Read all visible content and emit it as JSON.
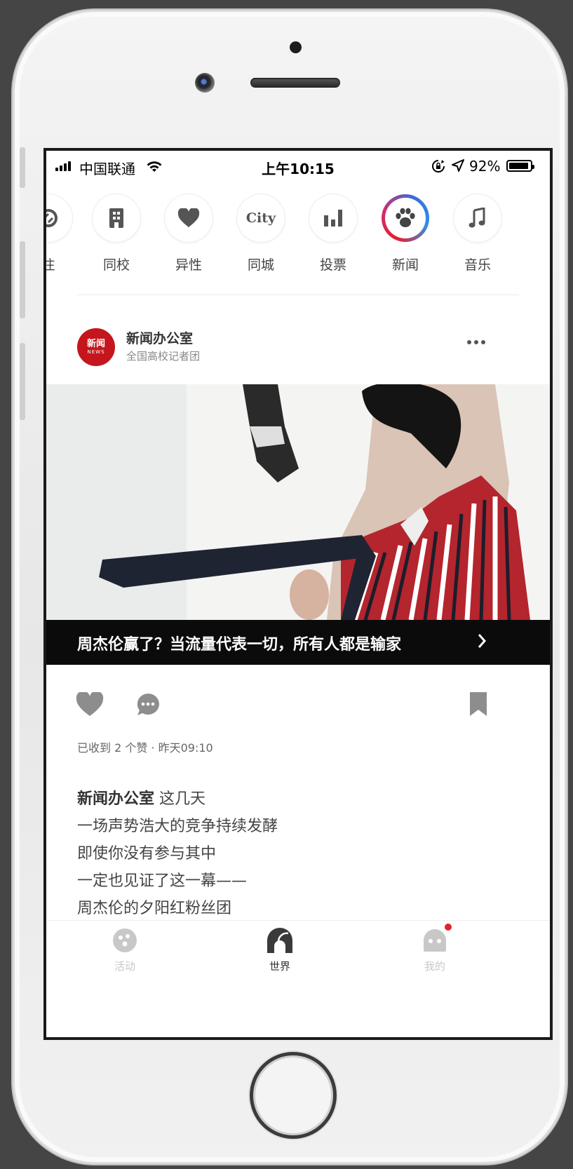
{
  "status_bar": {
    "carrier": "中国联通",
    "time": "上午10:15",
    "battery": "92%",
    "battery_level": 0.92
  },
  "categories": [
    {
      "label": "注",
      "icon": "focus-icon",
      "active": false
    },
    {
      "label": "同校",
      "icon": "building-icon",
      "active": false
    },
    {
      "label": "异性",
      "icon": "heart-icon",
      "active": false
    },
    {
      "label": "同城",
      "icon": "city-icon",
      "icon_text": "City",
      "active": false
    },
    {
      "label": "投票",
      "icon": "bar-chart-icon",
      "active": false
    },
    {
      "label": "新闻",
      "icon": "paw-icon",
      "active": true
    },
    {
      "label": "音乐",
      "icon": "music-note-icon",
      "active": false
    }
  ],
  "post": {
    "author": "新闻办公室",
    "author_subtitle": "全国高校记者团",
    "avatar_text_top": "新闻",
    "avatar_text_bottom": "NEWS",
    "caption": "周杰伦赢了？当流量代表一切，所有人都是输家",
    "meta": "已收到 2 个赞 · 昨天09:10",
    "body_lead": "新闻办公室",
    "body_first": " 这几天",
    "body_lines": [
      "一场声势浩大的竞争持续发酵",
      "即使你没有参与其中",
      "一定也见证了这一幕——",
      "周杰伦的夕阳红粉丝团"
    ]
  },
  "tabs": [
    {
      "label": "活动",
      "icon": "activity-icon",
      "active": false
    },
    {
      "label": "世界",
      "icon": "world-icon",
      "active": true
    },
    {
      "label": "我的",
      "icon": "profile-icon",
      "active": false,
      "badge": true
    }
  ],
  "colors": {
    "accent_red": "#e3222e",
    "tab_active": "#333333",
    "tab_inactive": "#c8c8c8",
    "caption_bg": "#0b0b0b"
  }
}
